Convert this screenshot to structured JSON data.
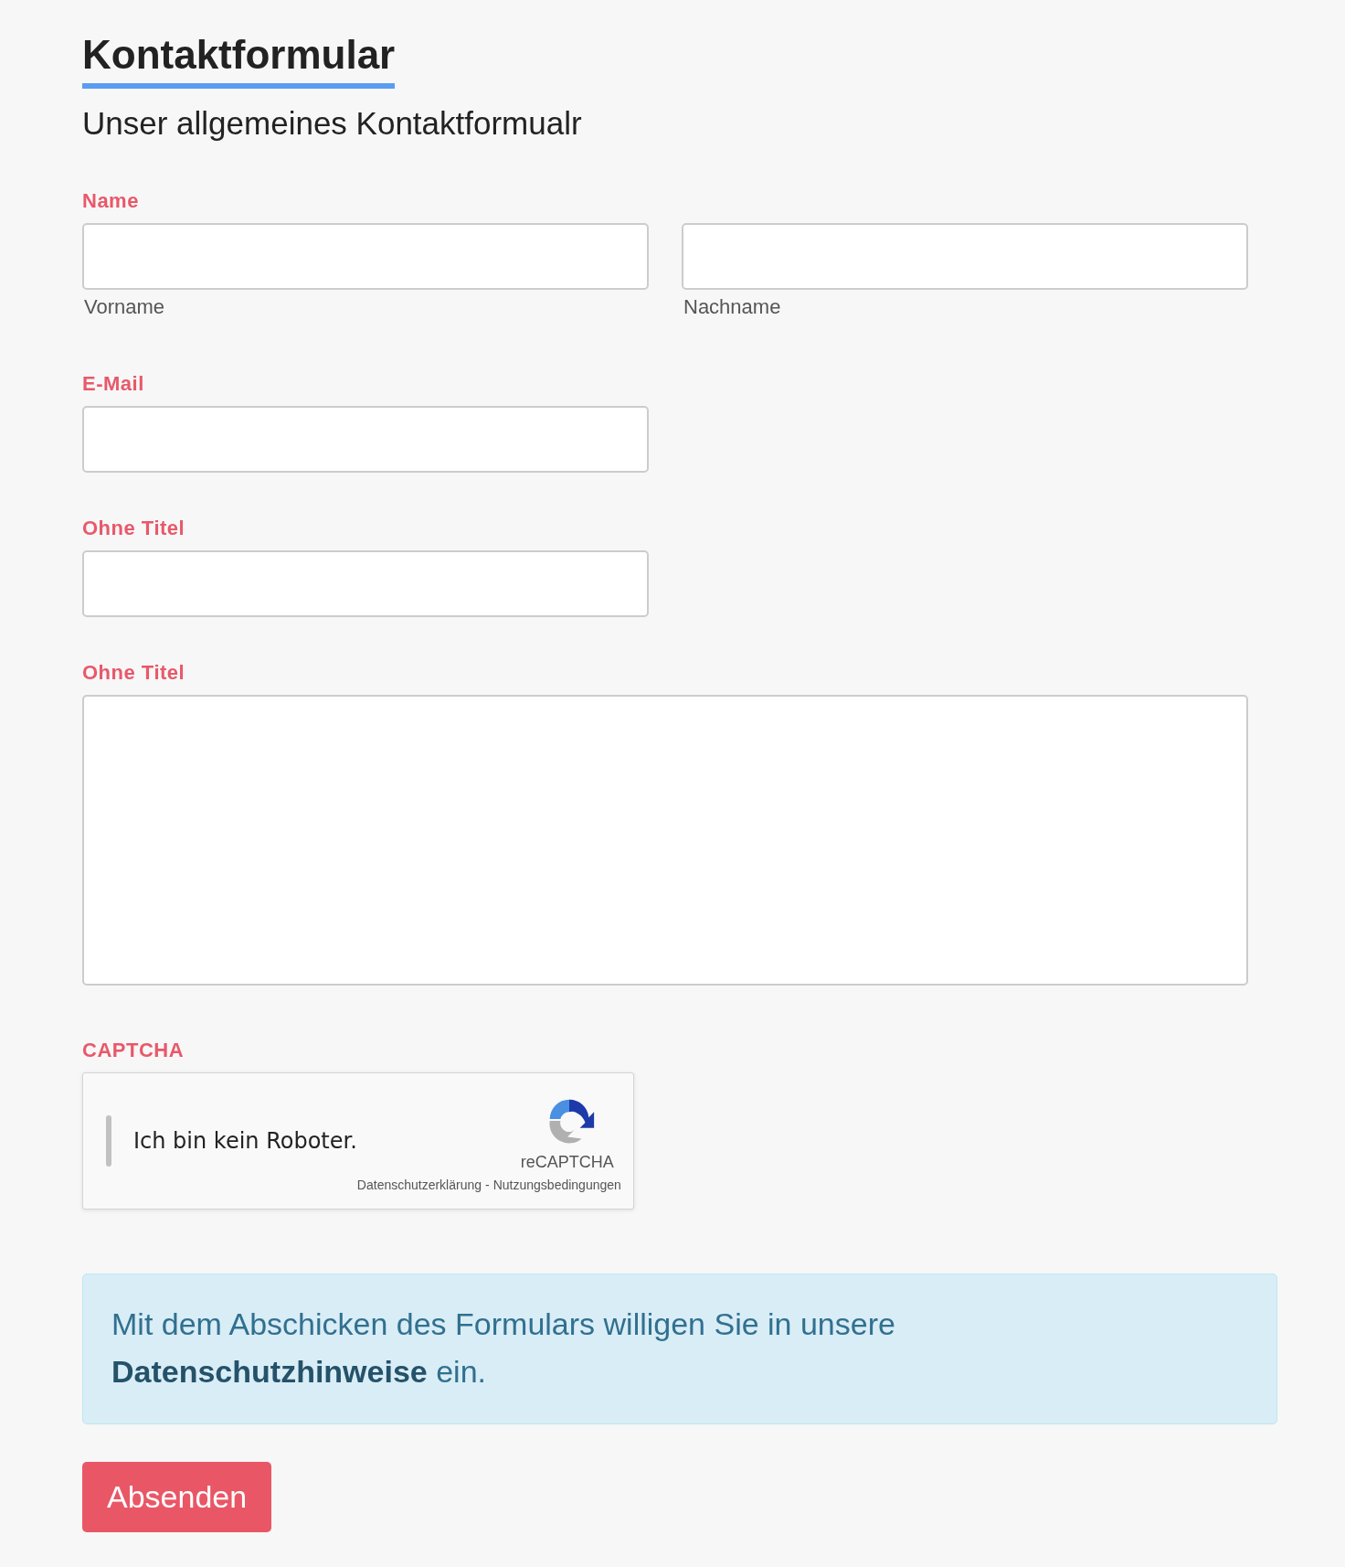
{
  "title": "Kontaktformular",
  "subtitle": "Unser allgemeines Kontaktformualr",
  "fields": [
    {
      "kind": "name",
      "label": "Name",
      "parts": [
        {
          "sublabel": "Vorname"
        },
        {
          "sublabel": "Nachname"
        }
      ]
    },
    {
      "kind": "input",
      "label": "E-Mail"
    },
    {
      "kind": "input",
      "label": "Ohne Titel"
    },
    {
      "kind": "textarea",
      "label": "Ohne Titel"
    },
    {
      "kind": "captcha",
      "label": "CAPTCHA",
      "checked": false,
      "text": "Ich bin kein Roboter.",
      "brand": "reCAPTCHA",
      "links": [
        "Datenschutzerklärung",
        "Nutzungsbedingungen"
      ],
      "separator": "-"
    }
  ],
  "notice": {
    "text": "Mit dem Abschicken des Formulars willigen Sie in unsere",
    "link": "Datenschutzhinweise",
    "after": "ein."
  },
  "submit": "Absenden"
}
